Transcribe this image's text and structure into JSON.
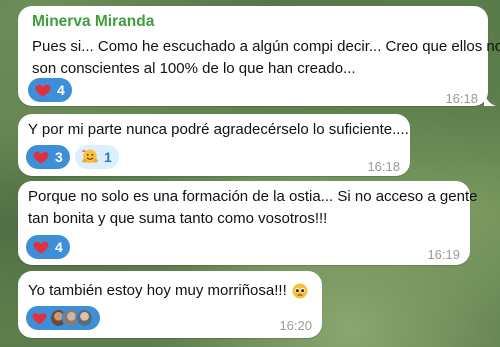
{
  "messages": [
    {
      "sender": "Minerva Miranda",
      "lines": [
        "Pues si... Como he escuchado a algún compi decir... Creo que ellos no",
        "son conscientes al 100% de lo que han creado..."
      ],
      "reactions": [
        {
          "icon": "heart-icon",
          "count": "4"
        }
      ],
      "time": "16:18"
    },
    {
      "lines": [
        "Y por mi parte nunca podré agradecérselo lo suficiente...."
      ],
      "reactions": [
        {
          "icon": "heart-icon",
          "count": "3"
        },
        {
          "icon": "hugging-face-icon",
          "count": "1"
        }
      ],
      "time": "16:18"
    },
    {
      "lines": [
        "Porque no solo es una formación de la ostia... Si no acceso a gente",
        "tan bonita y que suma tanto como vosotros!!!"
      ],
      "reactions": [
        {
          "icon": "heart-icon",
          "count": "4"
        }
      ],
      "time": "16:19"
    },
    {
      "lines": [
        "Yo también estoy hoy muy morriñosa!!!"
      ],
      "reactions": [
        {
          "icon": "heart-icon",
          "avatars": 3
        }
      ],
      "time": "16:20"
    }
  ],
  "colors": {
    "sender_name": "#3f9d3a",
    "reaction_active": "#3d8fd8",
    "reaction_inactive": "#dcefff",
    "heart": "#e0323e"
  }
}
